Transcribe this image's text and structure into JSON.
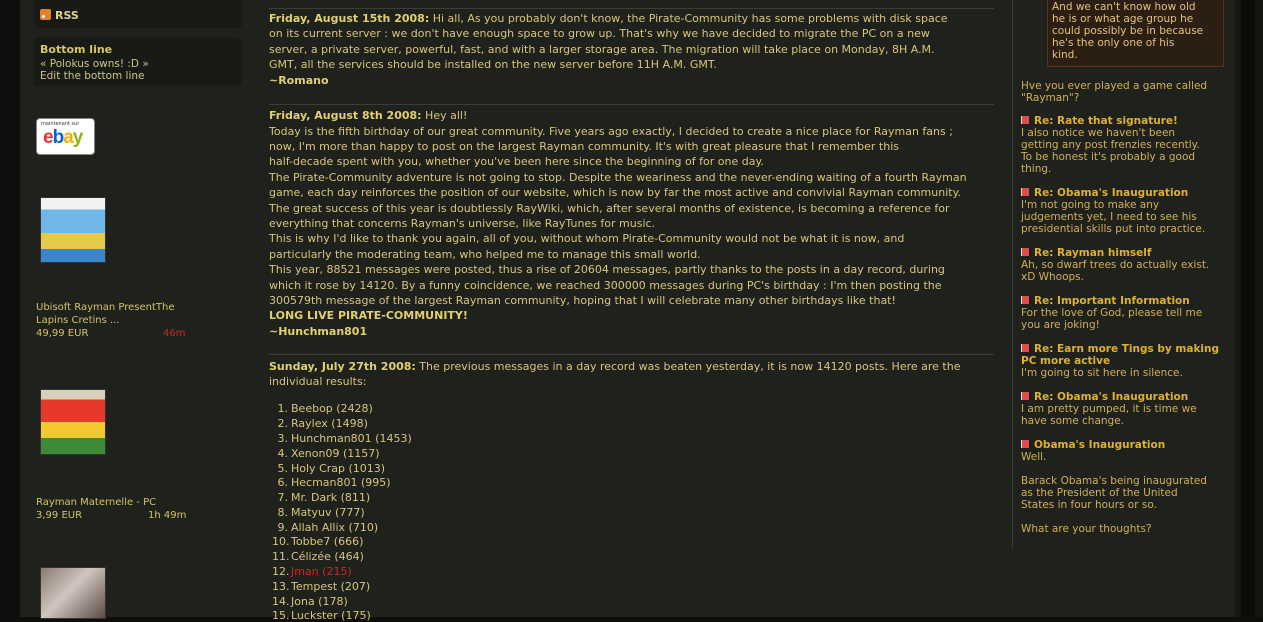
{
  "sidebar": {
    "rss_label": "RSS",
    "bottom_line": {
      "title": "Bottom line",
      "quote": "« Polokus owns! :D »",
      "edit_link": "Edit the bottom line"
    },
    "ebay": {
      "top_text": "maintenant sur",
      "logo": [
        "e",
        "b",
        "a",
        "y"
      ]
    },
    "products": [
      {
        "title_line1": "Ubisoft Rayman PresentThe",
        "title_line2": "Lapins Cretins ...",
        "price": "49,99 EUR",
        "time": "46m",
        "time_color": "#c42a2a"
      },
      {
        "title_line1": "Rayman Maternelle - PC",
        "title_line2": "",
        "price": "3,99 EUR",
        "time": "1h 49m",
        "time_color": "#d4c460"
      }
    ]
  },
  "news": [
    {
      "date": "Friday, August 15th 2008:",
      "lines": [
        " Hi all, As you probably don't know, the Pirate-Community has some problems with disk space",
        "on its current server : we don't have enough space to grow up. That's why we have decided to migrate the PC on a new",
        "server, a private server, powerful, fast, and with a larger storage area. The migration will take place on Monday, 8H A.M.",
        "GMT, all the services should be installed on the new server before 11H A.M. GMT."
      ],
      "signature": "~Romano"
    },
    {
      "date": "Friday, August 8th 2008:",
      "lines": [
        " Hey all!",
        "Today is the fifth birthday of our great community. Five years ago exactly, I decided to create a nice place for Rayman fans ;",
        "now, I'm more than happy to post on the largest Rayman community. It's with great pleasure that I remember this",
        "half-decade spent with you, whether you've been here since the beginning of for one day.",
        "The Pirate-Community adventure is not going to stop. Despite the weariness and the never-ending waiting of a fourth Rayman",
        "game, each day reinforces the position of our website, which is now by far the most active and convivial Rayman community.",
        "The great success of this year is doubtlessly RayWiki, which, after several months of existence, is becoming a reference for",
        "everything that concerns Rayman's universe, like RayTunes for music.",
        "This is why I'd like to thank you again, all of you, without whom Pirate-Community would not be what it is now, and",
        "particularly the moderating team, who helped me to manage this small world.",
        "This year, 88521 messages were posted, thus a rise of 20604 messages, partly thanks to the posts in a day record, during",
        "which it rose by 14120. By a funny coincidence, we reached 300000 messages during PC's birthday : I'm then posting the",
        "300579th message of the largest Rayman community, hoping that I will celebrate many other birthdays like that!"
      ],
      "shout": "LONG LIVE PIRATE-COMMUNITY!",
      "signature": "~Hunchman801"
    },
    {
      "date": "Sunday, July 27th 2008:",
      "lines": [
        " The previous messages in a day record was beaten yesterday, it is now 14120 posts. Here are the",
        "individual results:"
      ],
      "results": [
        "Beebop (2428)",
        "Raylex (1498)",
        "Hunchman801 (1453)",
        "Xenon09 (1157)",
        "Holy Crap (1013)",
        "Hecman801 (995)",
        "Mr. Dark (811)",
        "Matyuv (777)",
        "Allah Allix (710)",
        "Tobbe7 (666)",
        "Célizée (464)",
        "Jman (215)",
        "Tempest (207)",
        "Jona (178)",
        "Luckster (175)"
      ]
    }
  ],
  "right": {
    "quote_lines": [
      "And we can't know how old",
      "he is or what age group he",
      "could possibly be in because",
      "he's the only one of his",
      "kind."
    ],
    "intro_lines": [
      "Hve you ever played a game called",
      "\"Rayman\"?"
    ],
    "posts": [
      {
        "title": "Re: Rate that signature!",
        "lines": [
          "I also notice we haven't been",
          "getting any post frenzies recently.",
          "To be honest it's probably a good",
          "thing."
        ]
      },
      {
        "title": "Re: Obama's Inauguration",
        "lines": [
          "I'm not going to make any",
          "judgements yet, I need to see his",
          "presidential skills put into practice."
        ]
      },
      {
        "title": "Re: Rayman himself",
        "lines": [
          "Ah, so dwarf trees do actually exist.",
          "xD Whoops."
        ]
      },
      {
        "title": "Re: Important Information",
        "lines": [
          "For the love of God, please tell me",
          "you are joking!"
        ]
      },
      {
        "title": "Re: Earn more Tings by making",
        "title2": "PC more active",
        "lines": [
          "I'm going to sit here in silence."
        ]
      },
      {
        "title": "Re: Obama's Inauguration",
        "lines": [
          "I am pretty pumped, it is time we",
          "have some change."
        ]
      },
      {
        "title": "Obama's Inauguration",
        "lines": [
          "Well.",
          "",
          "Barack Obama's being inaugurated",
          "as the President of the United",
          "States in four hours or so.",
          "",
          "What are your thoughts?"
        ]
      }
    ]
  }
}
